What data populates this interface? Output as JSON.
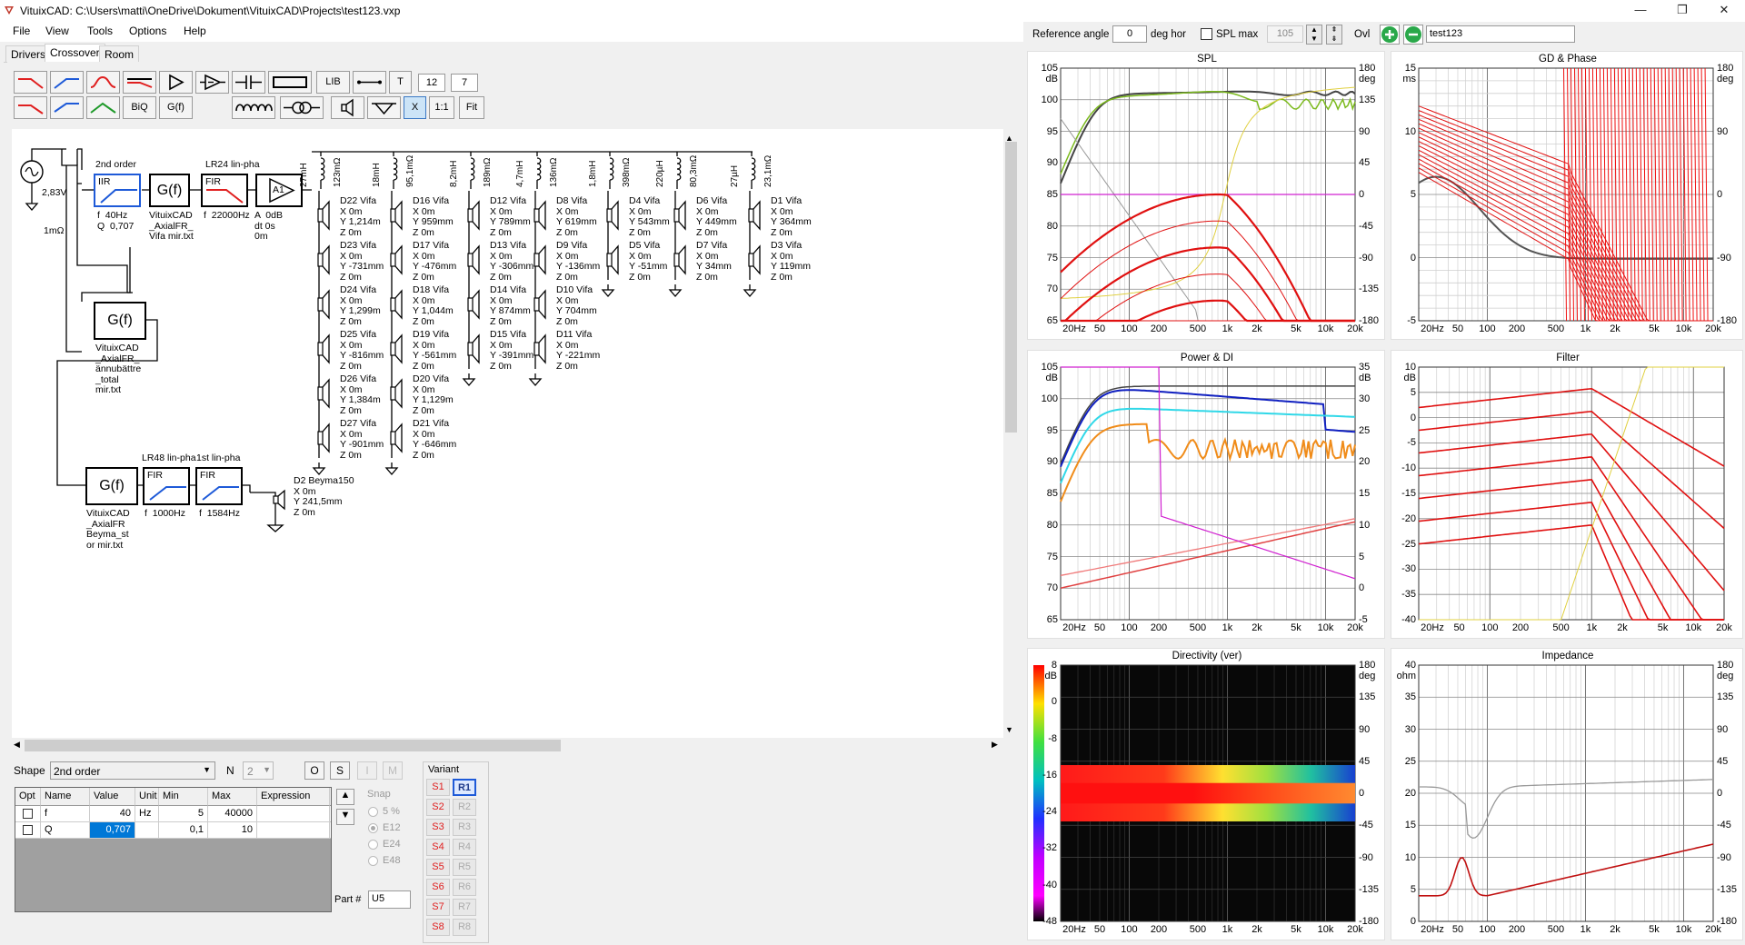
{
  "window": {
    "title": "VituixCAD: C:\\Users\\matti\\OneDrive\\Dokument\\VituixCAD\\Projects\\test123.vxp",
    "min": "—",
    "max": "❐",
    "close": "✕"
  },
  "menu": [
    "File",
    "View",
    "Tools",
    "Options",
    "Help"
  ],
  "tabs": [
    "Drivers",
    "Crossover",
    "Room"
  ],
  "toolbar": {
    "lib": "LIB",
    "t": "T",
    "n1": "12",
    "n2": "7",
    "biq": "BiQ",
    "gf": "G(f)",
    "x": "X",
    "one": "1:1",
    "fit": "Fit"
  },
  "graph_toolbar": {
    "ref_angle_label": "Reference angle",
    "ref_angle_value": "0",
    "deg_hor": "deg hor",
    "spl_max_label": "SPL max",
    "spl_max_value": "105",
    "ovl": "Ovl",
    "ovl_name": "test123"
  },
  "schematic": {
    "source": {
      "voltage": "2,83V",
      "r": "1mΩ"
    },
    "block1": {
      "title": "2nd order",
      "type": "IIR",
      "params": "f  40Hz\nQ  0,707"
    },
    "gf1": {
      "label": "G(f)",
      "desc": "VituixCAD\n_AxialFR_\nVifa mir.txt"
    },
    "block2": {
      "title": "LR24 lin-pha",
      "type": "FIR",
      "params": "f  22000Hz"
    },
    "amp": {
      "label": "A1",
      "params": "A  0dB\ndt 0s\n0m"
    },
    "gf2": {
      "label": "G(f)",
      "desc": "VituixCAD\n_AxialFR_\nännubättre\n_total\nmir.txt"
    },
    "gf3": {
      "label": "G(f)",
      "desc": "VituixCAD\n_AxialFR\nBeyma_st\nor mir.txt"
    },
    "block3": {
      "title": "LR48 lin-pha",
      "type": "FIR",
      "params": "f  1000Hz"
    },
    "block4": {
      "title": "1st lin-pha",
      "type": "FIR",
      "params": "f  1584Hz"
    },
    "d2": "D2 Beyma150\nX 0m\nY 241,5mm\nZ 0m",
    "inductors": [
      {
        "l": "27mH",
        "r": "123mΩ"
      },
      {
        "l": "18mH",
        "r": "95,1mΩ"
      },
      {
        "l": "8,2mH",
        "r": "189mΩ"
      },
      {
        "l": "4,7mH",
        "r": "136mΩ"
      },
      {
        "l": "1,8mH",
        "r": "398mΩ"
      },
      {
        "l": "220µH",
        "r": "80,3mΩ"
      },
      {
        "l": "27µH",
        "r": "23,1mΩ"
      }
    ],
    "columns": [
      [
        "D22 Vifa\nX 0m\nY 1,214m\nZ 0m",
        "D23 Vifa\nX 0m\nY -731mm\nZ 0m",
        "D24 Vifa\nX 0m\nY 1,299m\nZ 0m",
        "D25 Vifa\nX 0m\nY -816mm\nZ 0m",
        "D26 Vifa\nX 0m\nY 1,384m\nZ 0m",
        "D27 Vifa\nX 0m\nY -901mm\nZ 0m"
      ],
      [
        "D16 Vifa\nX 0m\nY 959mm\nZ 0m",
        "D17 Vifa\nX 0m\nY -476mm\nZ 0m",
        "D18 Vifa\nX 0m\nY 1,044m\nZ 0m",
        "D19 Vifa\nX 0m\nY -561mm\nZ 0m",
        "D20 Vifa\nX 0m\nY 1,129m\nZ 0m",
        "D21 Vifa\nX 0m\nY -646mm\nZ 0m"
      ],
      [
        "D12 Vifa\nX 0m\nY 789mm\nZ 0m",
        "D13 Vifa\nX 0m\nY -306mm\nZ 0m",
        "D14 Vifa\nX 0m\nY 874mm\nZ 0m",
        "D15 Vifa\nX 0m\nY -391mm\nZ 0m"
      ],
      [
        "D8 Vifa\nX 0m\nY 619mm\nZ 0m",
        "D9 Vifa\nX 0m\nY -136mm\nZ 0m",
        "D10 Vifa\nX 0m\nY 704mm\nZ 0m",
        "D11 Vifa\nX 0m\nY -221mm\nZ 0m"
      ],
      [
        "D4 Vifa\nX 0m\nY 543mm\nZ 0m",
        "D5 Vifa\nX 0m\nY -51mm\nZ 0m"
      ],
      [
        "D6 Vifa\nX 0m\nY 449mm\nZ 0m",
        "D7 Vifa\nX 0m\nY 34mm\nZ 0m"
      ],
      [
        "D1 Vifa\nX 0m\nY 364mm\nZ 0m",
        "D3 Vifa\nX 0m\nY 119mm\nZ 0m"
      ]
    ]
  },
  "shape": {
    "label": "Shape",
    "value": "2nd order",
    "n_label": "N",
    "n_value": "2",
    "o": "O",
    "s": "S",
    "i": "I",
    "m": "M"
  },
  "param_table": {
    "headers": [
      "Opt",
      "Name",
      "Value",
      "Unit",
      "Min",
      "Max",
      "Expression"
    ],
    "rows": [
      [
        "",
        "f",
        "40",
        "Hz",
        "5",
        "40000",
        ""
      ],
      [
        "",
        "Q",
        "0,707",
        "",
        "0,1",
        "10",
        ""
      ]
    ]
  },
  "snap": {
    "label": "Snap",
    "options": [
      "5 %",
      "E12",
      "E24",
      "E48"
    ],
    "selected": "E12"
  },
  "part": {
    "label": "Part #",
    "value": "U5"
  },
  "variant": {
    "label": "Variant",
    "s": [
      "S1",
      "S2",
      "S3",
      "S4",
      "S5",
      "S6",
      "S7",
      "S8"
    ],
    "r": [
      "R1",
      "R2",
      "R3",
      "R4",
      "R5",
      "R6",
      "R7",
      "R8"
    ]
  },
  "graphs": {
    "spl": {
      "title": "SPL",
      "yl_unit": "dB",
      "yr_unit": "deg",
      "yl": [
        "105",
        "100",
        "95",
        "90",
        "85",
        "80",
        "75",
        "70",
        "65"
      ],
      "yr": [
        "180",
        "135",
        "90",
        "45",
        "0",
        "-45",
        "-90",
        "-135",
        "-180"
      ],
      "x": [
        "20Hz",
        "50",
        "100",
        "200",
        "500",
        "1k",
        "2k",
        "5k",
        "10k",
        "20k"
      ]
    },
    "gd": {
      "title": "GD & Phase",
      "yl_unit": "ms",
      "yr_unit": "deg",
      "yl": [
        "15",
        "10",
        "5",
        "0",
        "-5"
      ],
      "yr": [
        "180",
        "90",
        "0",
        "-90",
        "-180"
      ],
      "x": [
        "20Hz",
        "50",
        "100",
        "200",
        "500",
        "1k",
        "2k",
        "5k",
        "10k",
        "20k"
      ]
    },
    "power": {
      "title": "Power & DI",
      "yl_unit": "dB",
      "yr_unit": "dB",
      "yl": [
        "105",
        "100",
        "95",
        "90",
        "85",
        "80",
        "75",
        "70",
        "65"
      ],
      "yr": [
        "35",
        "30",
        "25",
        "20",
        "15",
        "10",
        "5",
        "0",
        "-5"
      ],
      "x": [
        "20Hz",
        "50",
        "100",
        "200",
        "500",
        "1k",
        "2k",
        "5k",
        "10k",
        "20k"
      ]
    },
    "filter": {
      "title": "Filter",
      "yl_unit": "dB",
      "yl": [
        "10",
        "5",
        "0",
        "-5",
        "-10",
        "-15",
        "-20",
        "-25",
        "-30",
        "-35",
        "-40"
      ],
      "x": [
        "20Hz",
        "50",
        "100",
        "200",
        "500",
        "1k",
        "2k",
        "5k",
        "10k",
        "20k"
      ]
    },
    "directivity": {
      "title": "Directivity (ver)",
      "scale_unit": "dB",
      "scale": [
        "8",
        "0",
        "-8",
        "-16",
        "-24",
        "-32",
        "-40",
        "-48"
      ],
      "yr_unit": "deg",
      "yr": [
        "180",
        "135",
        "90",
        "45",
        "0",
        "-45",
        "-90",
        "-135",
        "-180"
      ],
      "x": [
        "20Hz",
        "50",
        "100",
        "200",
        "500",
        "1k",
        "2k",
        "5k",
        "10k",
        "20k"
      ]
    },
    "impedance": {
      "title": "Impedance",
      "yl_unit": "ohm",
      "yr_unit": "deg",
      "yl": [
        "40",
        "35",
        "30",
        "25",
        "20",
        "15",
        "10",
        "5",
        "0"
      ],
      "yr": [
        "180",
        "135",
        "90",
        "45",
        "0",
        "-45",
        "-90",
        "-135",
        "-180"
      ],
      "x": [
        "20Hz",
        "50",
        "100",
        "200",
        "500",
        "1k",
        "2k",
        "5k",
        "10k",
        "20k"
      ]
    }
  }
}
